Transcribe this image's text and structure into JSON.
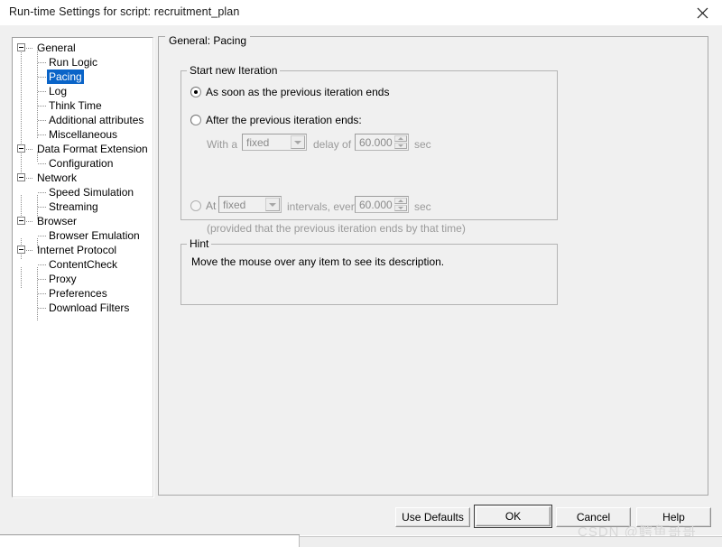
{
  "window": {
    "title": "Run-time Settings for script: recruitment_plan",
    "close_icon": "close-icon"
  },
  "tree": {
    "selected": "Pacing",
    "items": [
      {
        "label": "General",
        "level": 0,
        "expandable": true
      },
      {
        "label": "Run Logic",
        "level": 1,
        "expandable": false
      },
      {
        "label": "Pacing",
        "level": 1,
        "expandable": false
      },
      {
        "label": "Log",
        "level": 1,
        "expandable": false
      },
      {
        "label": "Think Time",
        "level": 1,
        "expandable": false
      },
      {
        "label": "Additional attributes",
        "level": 1,
        "expandable": false
      },
      {
        "label": "Miscellaneous",
        "level": 1,
        "expandable": false
      },
      {
        "label": "Data Format Extension",
        "level": 0,
        "expandable": true
      },
      {
        "label": "Configuration",
        "level": 1,
        "expandable": false
      },
      {
        "label": "Network",
        "level": 0,
        "expandable": true
      },
      {
        "label": "Speed Simulation",
        "level": 1,
        "expandable": false
      },
      {
        "label": "Streaming",
        "level": 1,
        "expandable": false
      },
      {
        "label": "Browser",
        "level": 0,
        "expandable": true
      },
      {
        "label": "Browser Emulation",
        "level": 1,
        "expandable": false
      },
      {
        "label": "Internet Protocol",
        "level": 0,
        "expandable": true
      },
      {
        "label": "ContentCheck",
        "level": 1,
        "expandable": false
      },
      {
        "label": "Proxy",
        "level": 1,
        "expandable": false
      },
      {
        "label": "Preferences",
        "level": 1,
        "expandable": false
      },
      {
        "label": "Download Filters",
        "level": 1,
        "expandable": false
      }
    ]
  },
  "content": {
    "panel_title": "General: Pacing",
    "start_group": {
      "title": "Start new Iteration",
      "option_immediate": "As soon as the previous iteration ends",
      "option_after": "After the previous iteration ends:",
      "after_row": {
        "prefix": "With a",
        "combo_value": "fixed",
        "middle": "delay of",
        "spin_value": "60.000",
        "suffix": "sec"
      },
      "option_at": "At",
      "at_row": {
        "combo_value": "fixed",
        "middle": "intervals, every",
        "spin_value": "60.000",
        "suffix": "sec"
      },
      "note": "(provided that the previous iteration ends by that time)"
    },
    "hint_group": {
      "title": "Hint",
      "text": "Move the mouse over any item to see its description."
    }
  },
  "footer": {
    "use_defaults": "Use Defaults",
    "ok": "OK",
    "cancel": "Cancel",
    "help": "Help"
  },
  "watermark": {
    "text": "CSDN @鳄鱼哥哥"
  },
  "colors": {
    "selection_blue": "#0a64c8",
    "dialog_face": "#f0f0f0",
    "tree_background": "#ffffff",
    "disabled_text": "#8d8d8d"
  }
}
